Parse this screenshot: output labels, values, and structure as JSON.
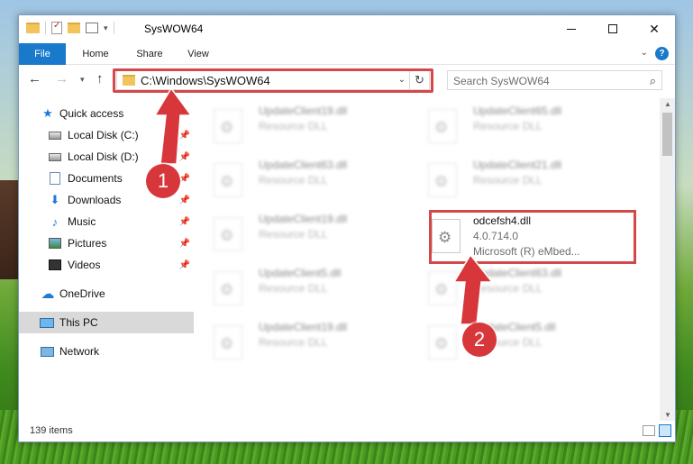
{
  "window": {
    "title": "SysWOW64"
  },
  "ribbon": {
    "tabs": [
      "File",
      "Home",
      "Share",
      "View"
    ]
  },
  "navigation": {
    "address_path": "C:\\Windows\\SysWOW64",
    "search_placeholder": "Search SysWOW64"
  },
  "sidebar": {
    "items": [
      {
        "label": "Quick access",
        "icon": "star-icon"
      },
      {
        "label": "Local Disk (C:)",
        "icon": "drive-icon",
        "pinned": true
      },
      {
        "label": "Local Disk (D:)",
        "icon": "drive-icon",
        "pinned": true
      },
      {
        "label": "Documents",
        "icon": "documents-icon",
        "pinned": true
      },
      {
        "label": "Downloads",
        "icon": "downloads-icon",
        "pinned": true
      },
      {
        "label": "Music",
        "icon": "music-icon",
        "pinned": true
      },
      {
        "label": "Pictures",
        "icon": "pictures-icon",
        "pinned": true
      },
      {
        "label": "Videos",
        "icon": "videos-icon",
        "pinned": true
      },
      {
        "label": "OneDrive",
        "icon": "onedrive-icon"
      },
      {
        "label": "This PC",
        "icon": "pc-icon",
        "selected": true
      },
      {
        "label": "Network",
        "icon": "network-icon"
      }
    ]
  },
  "files": [
    {
      "name": "UpdateClient19.dll",
      "line2": "Resource DLL",
      "line3": ""
    },
    {
      "name": "UpdateClient65.dll",
      "line2": "Resource DLL",
      "line3": ""
    },
    {
      "name": "UpdateClient63.dll",
      "line2": "Resource DLL",
      "line3": ""
    },
    {
      "name": "UpdateClient21.dll",
      "line2": "Resource DLL",
      "line3": ""
    },
    {
      "name": "UpdateClient19.dll",
      "line2": "Resource DLL",
      "line3": ""
    },
    {
      "name": "odcefsh4.dll",
      "line2": "4.0.714.0",
      "line3": "Microsoft (R) eMbed..."
    },
    {
      "name": "UpdateClient5.dll",
      "line2": "Resource DLL",
      "line3": ""
    },
    {
      "name": "UpdateClient63.dll",
      "line2": "Resource DLL",
      "line3": ""
    },
    {
      "name": "UpdateClient19.dll",
      "line2": "Resource DLL",
      "line3": ""
    },
    {
      "name": "UpdateClient5.dll",
      "line2": "Resource DLL",
      "line3": ""
    }
  ],
  "status": {
    "item_count": "139 items"
  },
  "annotations": {
    "step1": "1",
    "step2": "2",
    "color": "#d4484a"
  },
  "colors": {
    "accent": "#1979ca",
    "highlight": "#d4484a"
  }
}
